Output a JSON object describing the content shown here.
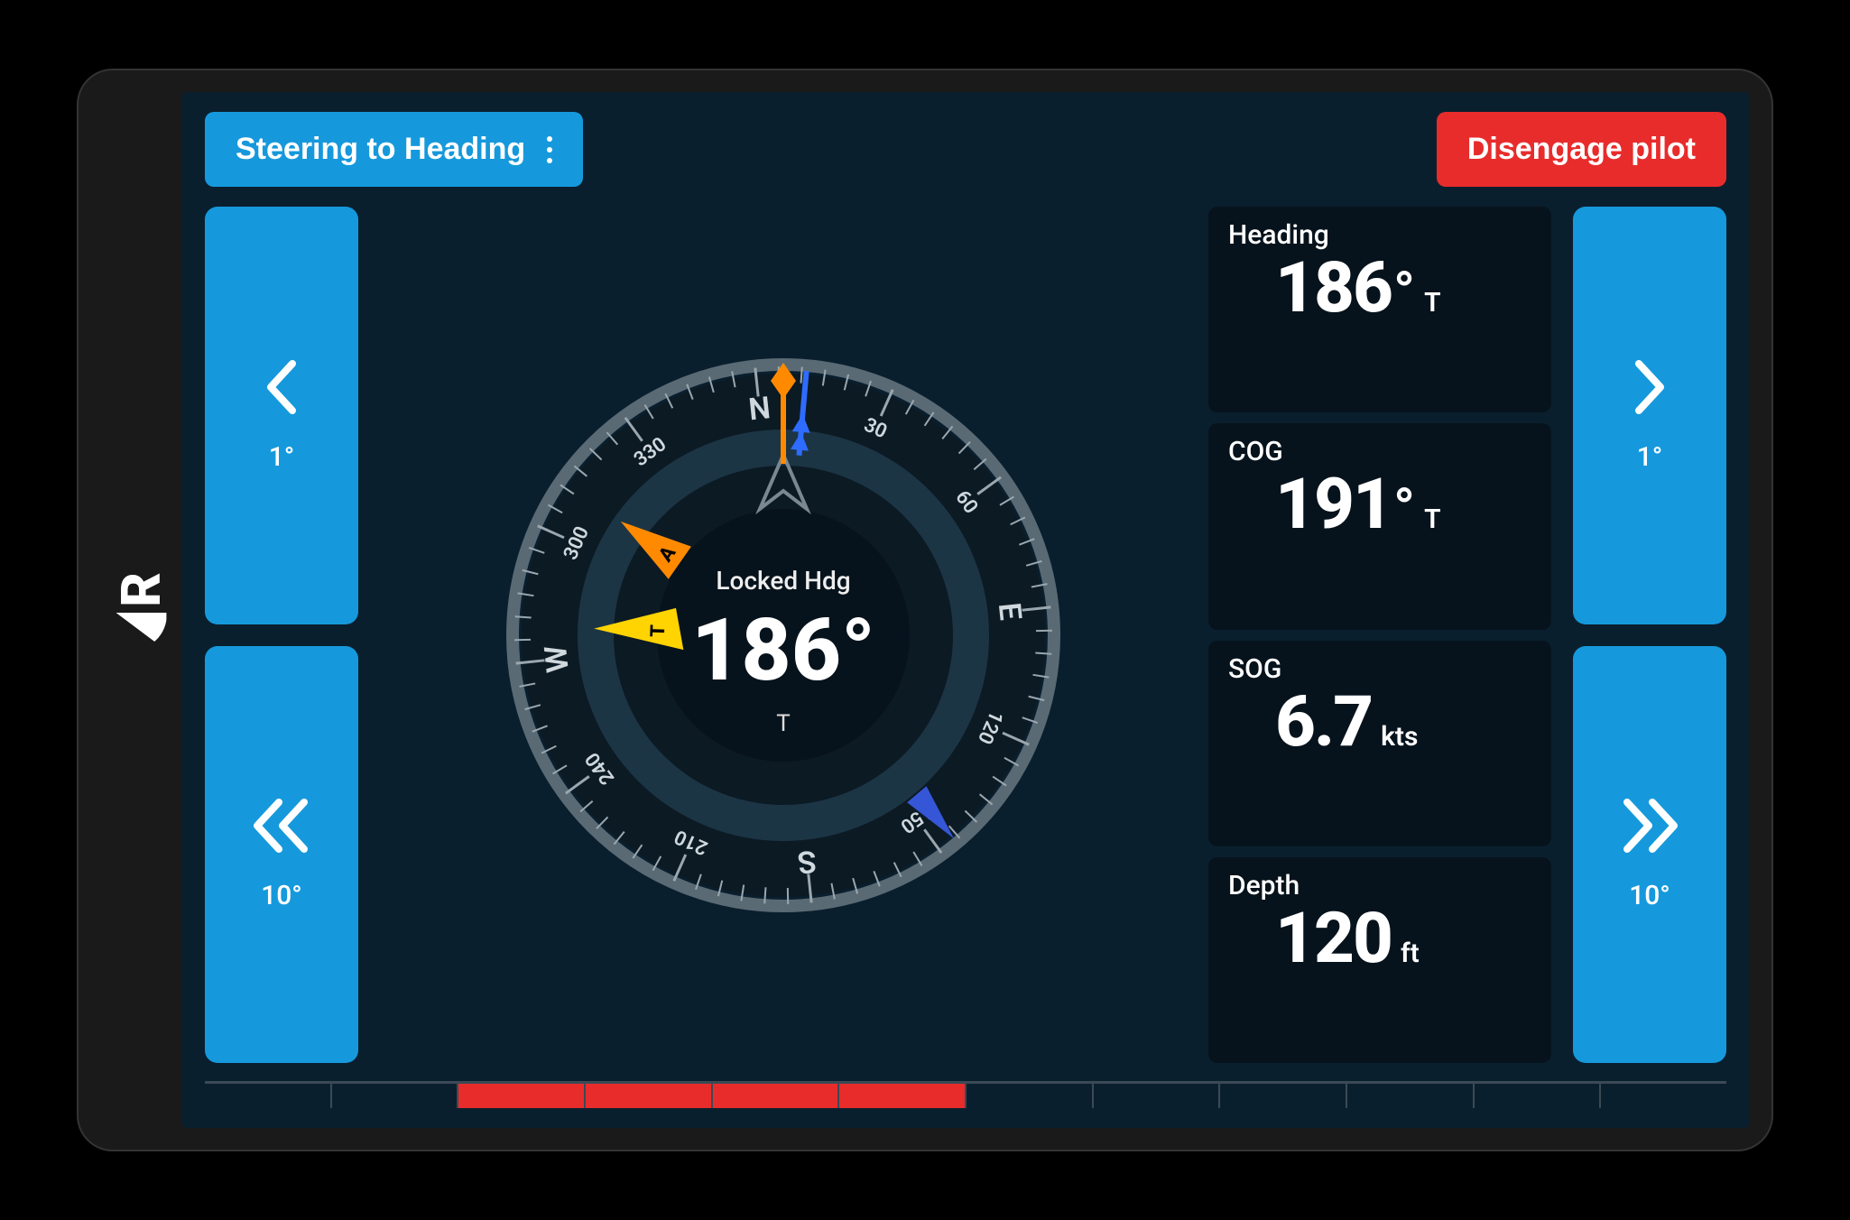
{
  "topbar": {
    "mode_label": "Steering to Heading",
    "disengage_label": "Disengage pilot"
  },
  "nudge": {
    "small_label": "1°",
    "large_label": "10°"
  },
  "compass": {
    "locked_label": "Locked Hdg",
    "locked_value": "186°",
    "locked_unit": "T",
    "current_heading_deg": 186,
    "cardinals": {
      "N": "N",
      "S": "S",
      "E": "E",
      "W": "W"
    },
    "tick_labels": [
      "30",
      "60",
      "120",
      "150",
      "210",
      "240",
      "300",
      "330"
    ],
    "pointer_A_label": "A",
    "pointer_T_label": "T"
  },
  "tiles": {
    "heading": {
      "label": "Heading",
      "value": "186",
      "degree": "°",
      "unit": "T"
    },
    "cog": {
      "label": "COG",
      "value": "191",
      "degree": "°",
      "unit": "T"
    },
    "sog": {
      "label": "SOG",
      "value": "6.7",
      "degree": "",
      "unit": "kts"
    },
    "depth": {
      "label": "Depth",
      "value": "120",
      "degree": "",
      "unit": "ft"
    }
  },
  "rudder": {
    "segments_total": 12,
    "red_segments_left_of_center": 4,
    "center_index": 6
  },
  "brand": "R",
  "colors": {
    "blue": "#1699dc",
    "red": "#e82c2c",
    "bg": "#0a1f2e",
    "tile": "#07131c",
    "orange": "#ff8a00",
    "yellow": "#ffd400",
    "cobalt": "#2e6cff"
  }
}
